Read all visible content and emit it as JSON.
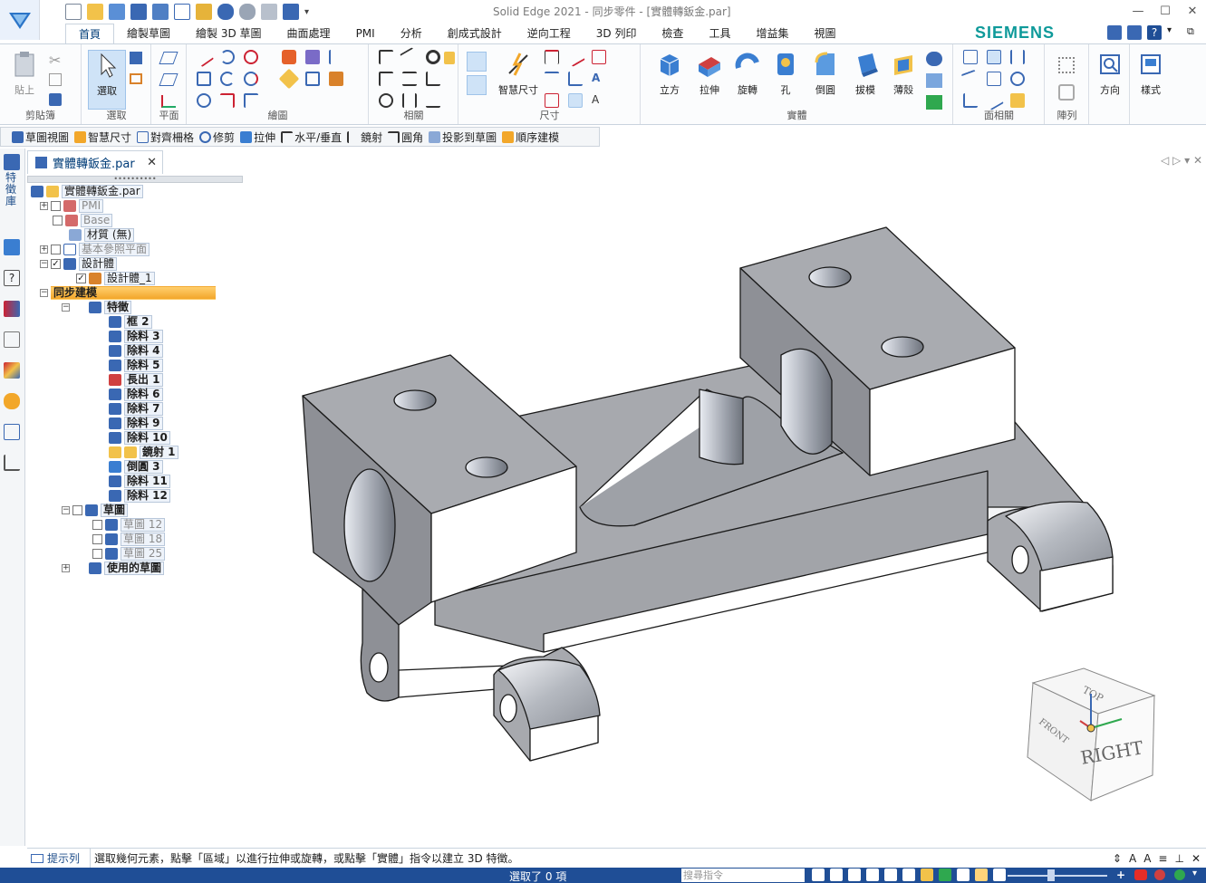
{
  "window": {
    "title": "Solid Edge 2021 - 同步零件 - [實體轉鈑金.par]",
    "controls": [
      "—",
      "☐",
      "✕"
    ]
  },
  "ribbon": {
    "brand": "SIEMENS",
    "tabs": [
      "首頁",
      "繪製草圖",
      "繪製 3D 草圖",
      "曲面處理",
      "PMI",
      "分析",
      "創成式設計",
      "逆向工程",
      "3D 列印",
      "檢查",
      "工具",
      "增益集",
      "視圖"
    ],
    "active_tab": "首頁",
    "groups": {
      "clipboard": {
        "label": "剪貼簿",
        "paste": "貼上"
      },
      "select": {
        "label": "選取",
        "select": "選取"
      },
      "plane": {
        "label": "平面"
      },
      "draw": {
        "label": "繪圖"
      },
      "relate": {
        "label": "相關"
      },
      "dimension": {
        "label": "尺寸",
        "smart_dim": "智慧尺寸"
      },
      "solids": {
        "label": "實體",
        "buttons": [
          "立方",
          "拉伸",
          "旋轉",
          "孔",
          "倒圓",
          "拔模",
          "薄殼"
        ]
      },
      "face_relate": {
        "label": "面相關"
      },
      "pattern": {
        "label": "陣列"
      },
      "orient": {
        "label": "方向"
      },
      "style": {
        "label": "樣式"
      }
    }
  },
  "command_bar": [
    "草圖視圖",
    "智慧尺寸",
    "對齊柵格",
    "修剪",
    "拉伸",
    "水平/垂直",
    "鏡射",
    "圓角",
    "投影到草圖",
    "順序建模"
  ],
  "left_strip": {
    "label": "特徵庫"
  },
  "document_tab": {
    "name": "實體轉鈑金.par",
    "close": "✕",
    "nav": "◁ ▷ ▾ ✕"
  },
  "tree": {
    "root": "實體轉鈑金.par",
    "pmi": "PMI",
    "base": "Base",
    "material": "材質 (無)",
    "ref_planes": "基本參照平面",
    "design_body": "設計體",
    "design_body_1": "設計體_1",
    "sync": "同步建模",
    "features": "特徵",
    "feature_items": [
      "框 2",
      "除料 3",
      "除料 4",
      "除料 5",
      "長出 1",
      "除料 6",
      "除料 7",
      "除料 9",
      "除料 10",
      "鏡射 1",
      "倒圓 3",
      "除料 11",
      "除料 12"
    ],
    "sketches": "草圖",
    "sketch_items": [
      "草圖 12",
      "草圖 18",
      "草圖 25"
    ],
    "used_sketches": "使用的草圖"
  },
  "viewcube": {
    "top": "TOP",
    "front": "FRONT",
    "right": "RIGHT"
  },
  "prompt": {
    "label": "提示列",
    "text": "選取幾何元素，點擊「區域」以進行拉伸或旋轉，或點擊「實體」指令以建立 3D 特徵。"
  },
  "status": {
    "message": "選取了 0 項",
    "search_placeholder": "搜尋指令"
  },
  "colors": {
    "accent": "#1f4e96",
    "brand": "#0f9a9a",
    "model": "#a9abb0"
  }
}
